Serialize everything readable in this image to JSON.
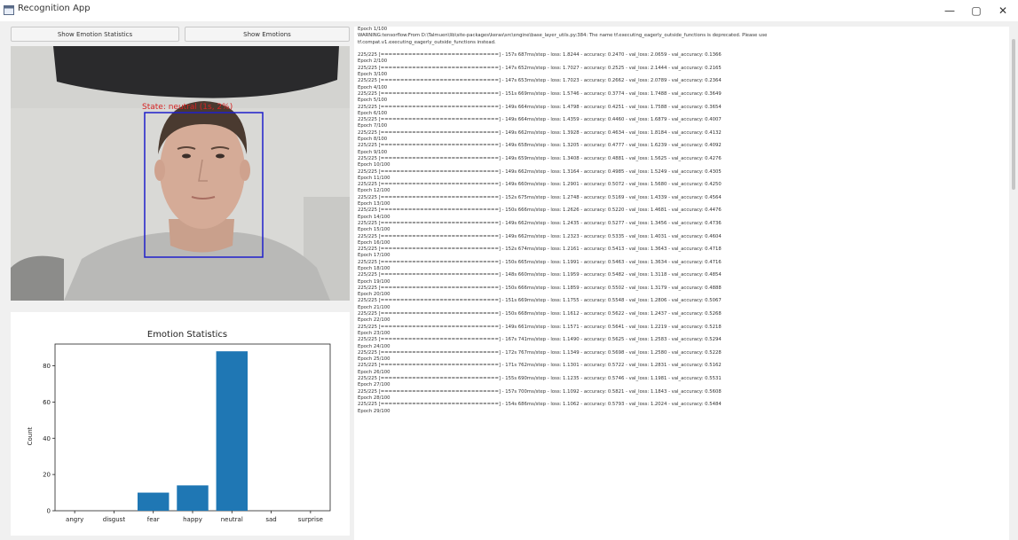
{
  "window": {
    "title": "Recognition App",
    "controls": [
      "—",
      "▢",
      "✕"
    ]
  },
  "buttons": {
    "stats_label": "Show Emotion Statistics",
    "emotion_label": "Show Emotions"
  },
  "camera": {
    "detection_label": "State: neutral (1s, 2%)",
    "box_color": "#1f1fcc",
    "label_color": "#d62424"
  },
  "chart_data": {
    "type": "bar",
    "title": "Emotion Statistics",
    "xlabel": "",
    "ylabel": "Count",
    "categories": [
      "angry",
      "disgust",
      "fear",
      "happy",
      "neutral",
      "sad",
      "surprise"
    ],
    "values": [
      0,
      0,
      10,
      14,
      88,
      0,
      0
    ],
    "ylim": [
      0,
      92
    ],
    "yticks": [
      0,
      20,
      40,
      60,
      80
    ],
    "bar_color": "#1f77b4",
    "grid": false
  },
  "log": {
    "lines": [
      "Epoch 1/100",
      "WARNING:tensorflow:From D:\\Talmuen\\lib\\site-packages\\keras\\src\\engine\\base_layer_utils.py:384: The name tf.executing_eagerly_outside_functions is deprecated. Please use",
      "tf.compat.v1.executing_eagerly_outside_functions instead.",
      "",
      "225/225 [==============================] - 157s 687ms/step - loss: 1.8244 - accuracy: 0.2470 - val_loss: 2.0659 - val_accuracy: 0.1366",
      "Epoch 2/100",
      "225/225 [==============================] - 147s 652ms/step - loss: 1.7027 - accuracy: 0.2525 - val_loss: 2.1444 - val_accuracy: 0.2165",
      "Epoch 3/100",
      "225/225 [==============================] - 147s 653ms/step - loss: 1.7023 - accuracy: 0.2662 - val_loss: 2.0789 - val_accuracy: 0.2364",
      "Epoch 4/100",
      "225/225 [==============================] - 151s 669ms/step - loss: 1.5746 - accuracy: 0.3774 - val_loss: 1.7488 - val_accuracy: 0.3649",
      "Epoch 5/100",
      "225/225 [==============================] - 149s 664ms/step - loss: 1.4798 - accuracy: 0.4251 - val_loss: 1.7588 - val_accuracy: 0.3654",
      "Epoch 6/100",
      "225/225 [==============================] - 149s 664ms/step - loss: 1.4359 - accuracy: 0.4460 - val_loss: 1.6879 - val_accuracy: 0.4007",
      "Epoch 7/100",
      "225/225 [==============================] - 149s 662ms/step - loss: 1.3928 - accuracy: 0.4634 - val_loss: 1.8184 - val_accuracy: 0.4132",
      "Epoch 8/100",
      "225/225 [==============================] - 149s 658ms/step - loss: 1.3205 - accuracy: 0.4777 - val_loss: 1.6239 - val_accuracy: 0.4092",
      "Epoch 9/100",
      "225/225 [==============================] - 149s 659ms/step - loss: 1.3408 - accuracy: 0.4881 - val_loss: 1.5625 - val_accuracy: 0.4276",
      "Epoch 10/100",
      "225/225 [==============================] - 149s 662ms/step - loss: 1.3164 - accuracy: 0.4985 - val_loss: 1.5249 - val_accuracy: 0.4305",
      "Epoch 11/100",
      "225/225 [==============================] - 149s 660ms/step - loss: 1.2901 - accuracy: 0.5072 - val_loss: 1.5680 - val_accuracy: 0.4250",
      "Epoch 12/100",
      "225/225 [==============================] - 152s 675ms/step - loss: 1.2748 - accuracy: 0.5169 - val_loss: 1.4339 - val_accuracy: 0.4564",
      "Epoch 13/100",
      "225/225 [==============================] - 150s 666ms/step - loss: 1.2626 - accuracy: 0.5220 - val_loss: 1.4681 - val_accuracy: 0.4476",
      "Epoch 14/100",
      "225/225 [==============================] - 149s 662ms/step - loss: 1.2435 - accuracy: 0.5277 - val_loss: 1.3456 - val_accuracy: 0.4736",
      "Epoch 15/100",
      "225/225 [==============================] - 149s 662ms/step - loss: 1.2323 - accuracy: 0.5335 - val_loss: 1.4031 - val_accuracy: 0.4604",
      "Epoch 16/100",
      "225/225 [==============================] - 152s 674ms/step - loss: 1.2161 - accuracy: 0.5413 - val_loss: 1.3643 - val_accuracy: 0.4718",
      "Epoch 17/100",
      "225/225 [==============================] - 150s 665ms/step - loss: 1.1991 - accuracy: 0.5463 - val_loss: 1.3634 - val_accuracy: 0.4716",
      "Epoch 18/100",
      "225/225 [==============================] - 148s 660ms/step - loss: 1.1959 - accuracy: 0.5482 - val_loss: 1.3118 - val_accuracy: 0.4854",
      "Epoch 19/100",
      "225/225 [==============================] - 150s 666ms/step - loss: 1.1859 - accuracy: 0.5502 - val_loss: 1.3179 - val_accuracy: 0.4888",
      "Epoch 20/100",
      "225/225 [==============================] - 151s 669ms/step - loss: 1.1755 - accuracy: 0.5548 - val_loss: 1.2806 - val_accuracy: 0.5067",
      "Epoch 21/100",
      "225/225 [==============================] - 150s 668ms/step - loss: 1.1612 - accuracy: 0.5622 - val_loss: 1.2437 - val_accuracy: 0.5268",
      "Epoch 22/100",
      "225/225 [==============================] - 149s 661ms/step - loss: 1.1571 - accuracy: 0.5641 - val_loss: 1.2219 - val_accuracy: 0.5218",
      "Epoch 23/100",
      "225/225 [==============================] - 167s 741ms/step - loss: 1.1490 - accuracy: 0.5625 - val_loss: 1.2583 - val_accuracy: 0.5294",
      "Epoch 24/100",
      "225/225 [==============================] - 172s 767ms/step - loss: 1.1349 - accuracy: 0.5698 - val_loss: 1.2580 - val_accuracy: 0.5228",
      "Epoch 25/100",
      "225/225 [==============================] - 171s 762ms/step - loss: 1.1301 - accuracy: 0.5722 - val_loss: 1.2831 - val_accuracy: 0.5162",
      "Epoch 26/100",
      "225/225 [==============================] - 155s 690ms/step - loss: 1.1235 - accuracy: 0.5746 - val_loss: 1.1981 - val_accuracy: 0.5531",
      "Epoch 27/100",
      "225/225 [==============================] - 157s 700ms/step - loss: 1.1092 - accuracy: 0.5821 - val_loss: 1.1843 - val_accuracy: 0.5608",
      "Epoch 28/100",
      "225/225 [==============================] - 154s 686ms/step - loss: 1.1062 - accuracy: 0.5793 - val_loss: 1.2024 - val_accuracy: 0.5484",
      "Epoch 29/100"
    ]
  }
}
